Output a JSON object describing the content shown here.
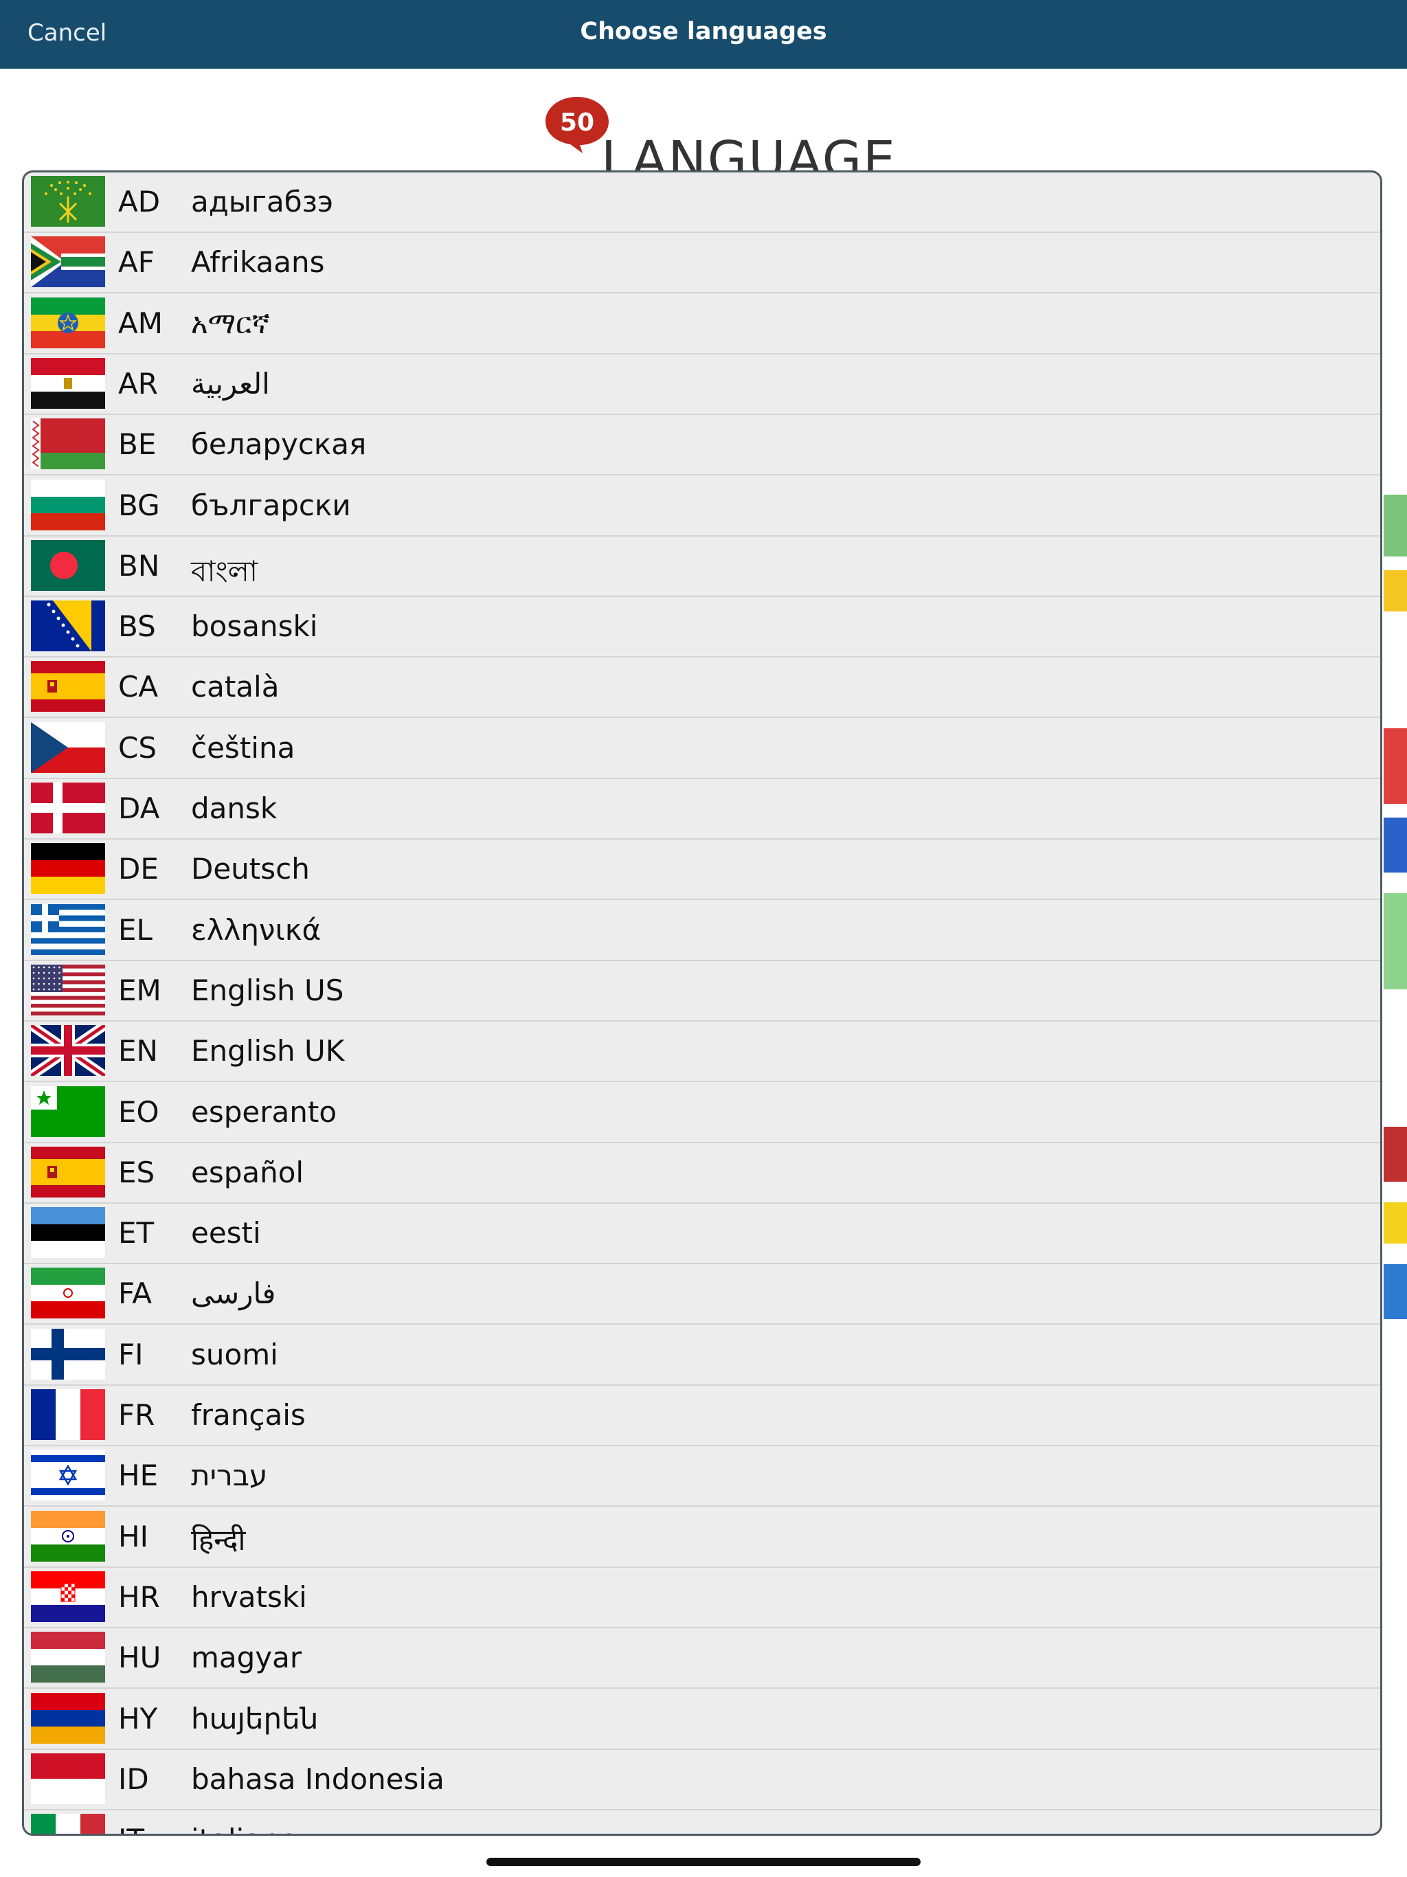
{
  "nav": {
    "cancel": "Cancel",
    "title": "Choose languages"
  },
  "brand": {
    "badge": "50",
    "text": "LANGUAGES"
  },
  "colors": {
    "navbar": "#174c6c",
    "badge": "#c0281e",
    "panel": "#ededed"
  },
  "languages": [
    {
      "code": "AD",
      "name": "адыгабзэ",
      "flag": "adyghe-flag-icon"
    },
    {
      "code": "AF",
      "name": "Afrikaans",
      "flag": "south-africa-flag-icon"
    },
    {
      "code": "AM",
      "name": "አማርኛ",
      "flag": "ethiopia-flag-icon"
    },
    {
      "code": "AR",
      "name": "العربية",
      "flag": "egypt-flag-icon"
    },
    {
      "code": "BE",
      "name": "беларуская",
      "flag": "belarus-flag-icon"
    },
    {
      "code": "BG",
      "name": "български",
      "flag": "bulgaria-flag-icon"
    },
    {
      "code": "BN",
      "name": "বাংলা",
      "flag": "bangladesh-flag-icon"
    },
    {
      "code": "BS",
      "name": "bosanski",
      "flag": "bosnia-flag-icon"
    },
    {
      "code": "CA",
      "name": "català",
      "flag": "spain-flag-icon"
    },
    {
      "code": "CS",
      "name": "čeština",
      "flag": "czech-flag-icon"
    },
    {
      "code": "DA",
      "name": "dansk",
      "flag": "denmark-flag-icon"
    },
    {
      "code": "DE",
      "name": "Deutsch",
      "flag": "germany-flag-icon"
    },
    {
      "code": "EL",
      "name": "ελληνικά",
      "flag": "greece-flag-icon"
    },
    {
      "code": "EM",
      "name": "English US",
      "flag": "usa-flag-icon"
    },
    {
      "code": "EN",
      "name": "English UK",
      "flag": "uk-flag-icon"
    },
    {
      "code": "EO",
      "name": "esperanto",
      "flag": "esperanto-flag-icon"
    },
    {
      "code": "ES",
      "name": "español",
      "flag": "spain-flag-icon"
    },
    {
      "code": "ET",
      "name": "eesti",
      "flag": "estonia-flag-icon"
    },
    {
      "code": "FA",
      "name": "فارسی",
      "flag": "iran-flag-icon"
    },
    {
      "code": "FI",
      "name": "suomi",
      "flag": "finland-flag-icon"
    },
    {
      "code": "FR",
      "name": "français",
      "flag": "france-flag-icon"
    },
    {
      "code": "HE",
      "name": "עברית",
      "flag": "israel-flag-icon"
    },
    {
      "code": "HI",
      "name": "हिन्दी",
      "flag": "india-flag-icon"
    },
    {
      "code": "HR",
      "name": "hrvatski",
      "flag": "croatia-flag-icon"
    },
    {
      "code": "HU",
      "name": "magyar",
      "flag": "hungary-flag-icon"
    },
    {
      "code": "HY",
      "name": "հայերեն",
      "flag": "armenia-flag-icon"
    },
    {
      "code": "ID",
      "name": "bahasa Indonesia",
      "flag": "indonesia-flag-icon"
    },
    {
      "code": "IT",
      "name": "italiano",
      "flag": "italy-flag-icon"
    }
  ]
}
